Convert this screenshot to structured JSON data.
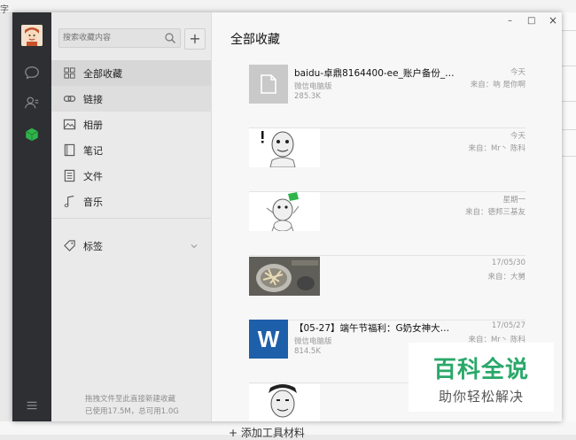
{
  "window": {
    "title": "全部收藏",
    "controls": {
      "minimize": "–",
      "maximize": "□",
      "close": "×"
    }
  },
  "nav": {
    "icons": [
      "avatar",
      "chat-icon",
      "contacts-icon",
      "favorites-cube-icon",
      "menu-icon"
    ]
  },
  "search": {
    "placeholder": "搜索收藏内容",
    "add_label": "+"
  },
  "categories": [
    {
      "label": "全部收藏",
      "icon": "grid-icon"
    },
    {
      "label": "链接",
      "icon": "link-icon"
    },
    {
      "label": "相册",
      "icon": "photo-icon"
    },
    {
      "label": "笔记",
      "icon": "note-icon"
    },
    {
      "label": "文件",
      "icon": "file-icon"
    },
    {
      "label": "音乐",
      "icon": "music-icon"
    }
  ],
  "tags": {
    "label": "标签",
    "icon": "tag-icon"
  },
  "footer": {
    "line1": "拖拽文件至此直接新建收藏",
    "line2": "已使用17.5M，总可用1.0G"
  },
  "items": [
    {
      "type": "file",
      "title": "baidu-卓鼎8164400-ee_账户备份_2...",
      "sub": "微信电脑版",
      "size": "285.3K",
      "date": "今天",
      "from": "来自：吶 是你啊"
    },
    {
      "type": "image",
      "title": "",
      "sub": "",
      "size": "",
      "date": "今天",
      "from": "来自：Mr丶 陈科"
    },
    {
      "type": "image",
      "title": "",
      "sub": "",
      "size": "",
      "date": "星期一",
      "from": "来自：德邦三基友"
    },
    {
      "type": "image",
      "title": "",
      "sub": "",
      "size": "",
      "date": "17/05/30",
      "from": "来自：大舅"
    },
    {
      "type": "word",
      "title": "【05-27】端午节福利：G奶女神大粽...",
      "sub": "微信电脑版",
      "size": "814.5K",
      "date": "17/05/27",
      "from": "来自：Mr丶 陈科"
    },
    {
      "type": "image",
      "title": "",
      "sub": "",
      "size": "",
      "date": "",
      "from": ""
    }
  ],
  "word_letter": "W",
  "watermark": {
    "big": "百科全说",
    "small": "助你轻松解决"
  },
  "background": {
    "bottom_text": "+ 添加工具材料",
    "left_glyph": "字"
  },
  "colors": {
    "nav_bg": "#2d2f33",
    "accent_green": "#2fb44b",
    "word_blue": "#1d5fa8",
    "watermark_green": "#2aa86a"
  }
}
